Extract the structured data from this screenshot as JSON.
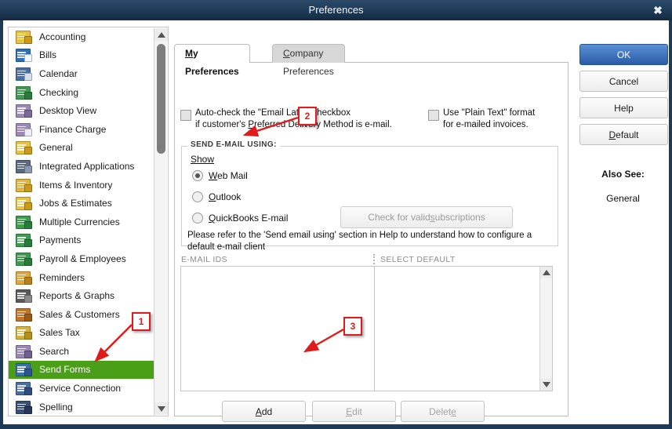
{
  "window": {
    "title": "Preferences",
    "close_icon": "close-icon"
  },
  "sidebar": {
    "items": [
      {
        "label": "Accounting",
        "icon": "accounting-icon",
        "selected": false
      },
      {
        "label": "Bills",
        "icon": "bills-icon",
        "selected": false
      },
      {
        "label": "Calendar",
        "icon": "calendar-icon",
        "selected": false
      },
      {
        "label": "Checking",
        "icon": "checking-icon",
        "selected": false
      },
      {
        "label": "Desktop View",
        "icon": "desktop-view-icon",
        "selected": false
      },
      {
        "label": "Finance Charge",
        "icon": "finance-charge-icon",
        "selected": false
      },
      {
        "label": "General",
        "icon": "general-icon",
        "selected": false
      },
      {
        "label": "Integrated Applications",
        "icon": "integrated-applications-icon",
        "selected": false
      },
      {
        "label": "Items & Inventory",
        "icon": "items-inventory-icon",
        "selected": false
      },
      {
        "label": "Jobs & Estimates",
        "icon": "jobs-estimates-icon",
        "selected": false
      },
      {
        "label": "Multiple Currencies",
        "icon": "multiple-currencies-icon",
        "selected": false
      },
      {
        "label": "Payments",
        "icon": "payments-icon",
        "selected": false
      },
      {
        "label": "Payroll & Employees",
        "icon": "payroll-employees-icon",
        "selected": false
      },
      {
        "label": "Reminders",
        "icon": "reminders-icon",
        "selected": false
      },
      {
        "label": "Reports & Graphs",
        "icon": "reports-graphs-icon",
        "selected": false
      },
      {
        "label": "Sales & Customers",
        "icon": "sales-customers-icon",
        "selected": false
      },
      {
        "label": "Sales Tax",
        "icon": "sales-tax-icon",
        "selected": false
      },
      {
        "label": "Search",
        "icon": "search-icon",
        "selected": false
      },
      {
        "label": "Send Forms",
        "icon": "send-forms-icon",
        "selected": true
      },
      {
        "label": "Service Connection",
        "icon": "service-connection-icon",
        "selected": false
      },
      {
        "label": "Spelling",
        "icon": "spelling-icon",
        "selected": false
      }
    ],
    "scrollbar": {
      "up_icon": "scroll-up-arrow-icon",
      "down_icon": "scroll-down-arrow-icon"
    }
  },
  "tabs": [
    {
      "label": "My Preferences",
      "mnemonic": "M",
      "active": true
    },
    {
      "label": "Company Preferences",
      "mnemonic": "C",
      "active": false
    }
  ],
  "panel": {
    "checkbox_email_later": {
      "line1": "Auto-check the \"Email Later\" checkbox",
      "line2_pre": "if customer's ",
      "line2_mnemonic": "P",
      "line2_post": "referred Delivery Method is e-mail.",
      "checked": false
    },
    "checkbox_plain_text": {
      "line1": "Use \"Plain Text\" format",
      "line2": "for e-mailed invoices.",
      "checked": false
    },
    "group_title": "SEND E-MAIL USING:",
    "show_label": "Show",
    "radios": [
      {
        "label": "Web Mail",
        "mnemonic": "W",
        "rest": "eb Mail",
        "selected": true
      },
      {
        "label": "Outlook",
        "mnemonic": "O",
        "rest": "utlook",
        "selected": false
      },
      {
        "label": "QuickBooks E-mail",
        "mnemonic": "Q",
        "rest": "uickBooks E-mail",
        "selected": false
      }
    ],
    "subscriptions_button": {
      "pre": "Check for valid ",
      "mnemonic": "s",
      "post": "ubscriptions",
      "enabled": false
    },
    "note": "Please refer to the 'Send email using' section in Help to understand how to configure a default e-mail client",
    "list_headers": [
      "E-MAIL IDS",
      "SELECT DEFAULT"
    ],
    "email_ids": [],
    "select_default": [],
    "buttons": [
      {
        "label": "Add",
        "mnemonic": "A",
        "pre": "",
        "post": "dd",
        "enabled": true
      },
      {
        "label": "Edit",
        "mnemonic": "E",
        "pre": "",
        "post": "dit",
        "enabled": false
      },
      {
        "label": "Delete",
        "mnemonic": "e",
        "pre": "Delet",
        "post": "",
        "enabled": false
      }
    ]
  },
  "right_panel": {
    "ok": "OK",
    "cancel": "Cancel",
    "help": "Help",
    "default_pre": "D",
    "default_post": "efault",
    "also_see_label": "Also See:",
    "also_see_link": "General"
  },
  "annotations": [
    {
      "number": "1",
      "points_to": "sidebar-item-send-forms"
    },
    {
      "number": "2",
      "points_to": "radio-web-mail"
    },
    {
      "number": "3",
      "points_to": "add-button"
    }
  ],
  "colors": {
    "titlebar": "#1d3a57",
    "selection_green": "#4a9e18",
    "primary_button": "#2a5ca8",
    "annotation_red": "#e01b1b"
  }
}
